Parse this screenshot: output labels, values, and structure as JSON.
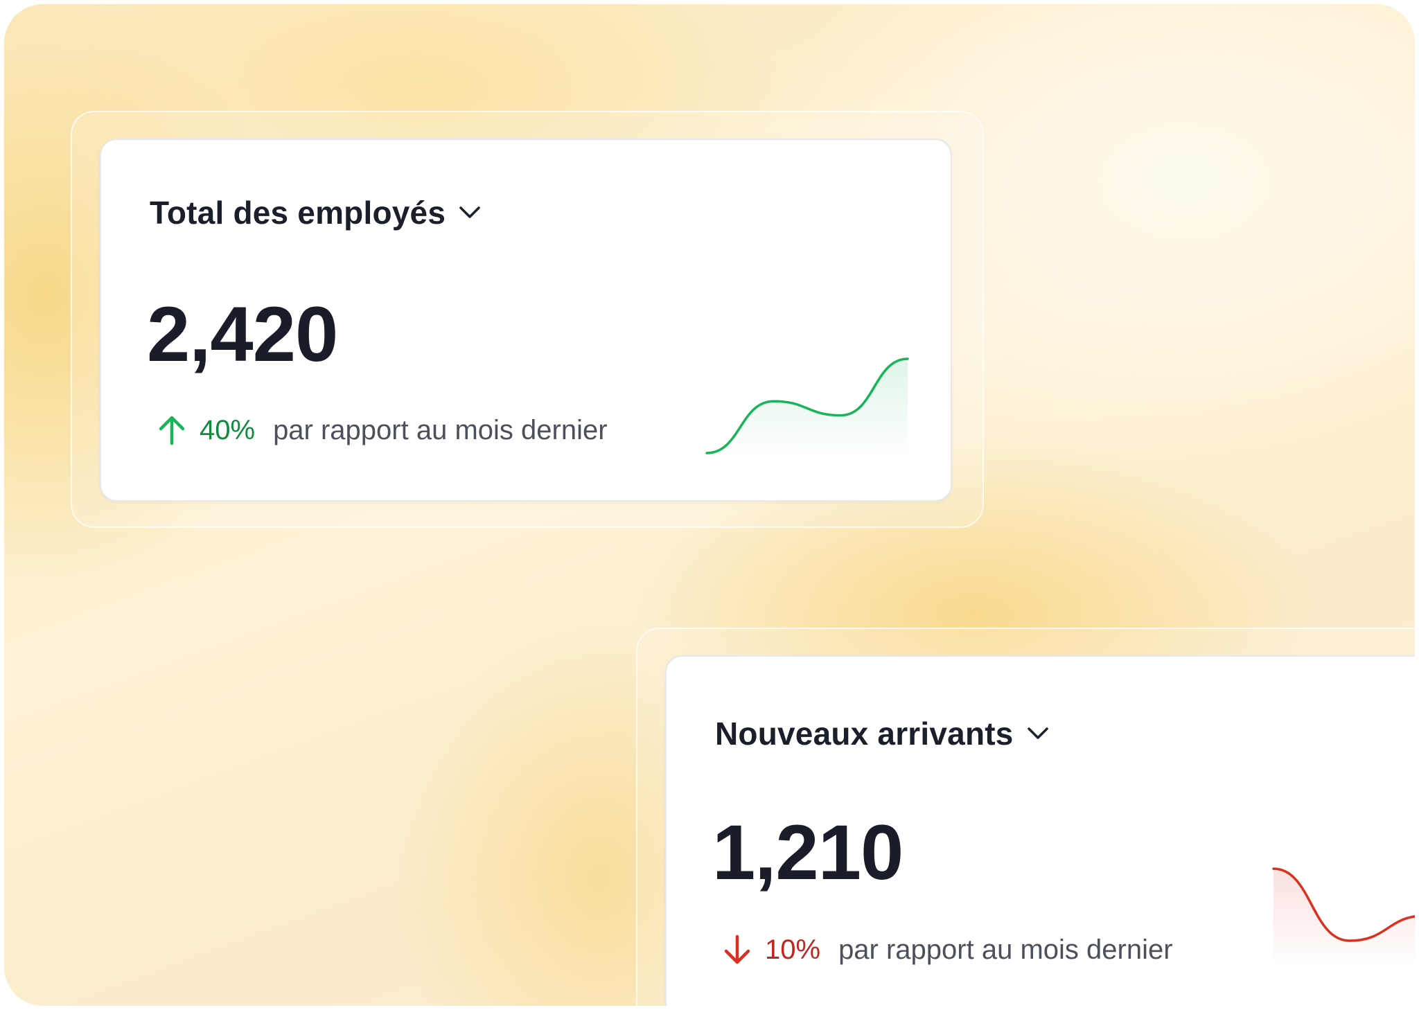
{
  "cards": [
    {
      "title": "Total des employés",
      "value": "2,420",
      "change": "40%",
      "direction": "up",
      "caption": "par rapport au mois dernier",
      "color": "#19b35a",
      "trend": [
        0.0,
        0.55,
        0.4,
        1.0
      ]
    },
    {
      "title": "Nouveaux arrivants",
      "value": "1,210",
      "change": "10%",
      "direction": "down",
      "caption": "par rapport au mois dernier",
      "color": "#d9301f",
      "trend": [
        1.0,
        0.0,
        0.35
      ]
    }
  ],
  "icons": {
    "dropdown": "chevron-down-icon",
    "up": "arrow-up-icon",
    "down": "arrow-down-icon"
  }
}
